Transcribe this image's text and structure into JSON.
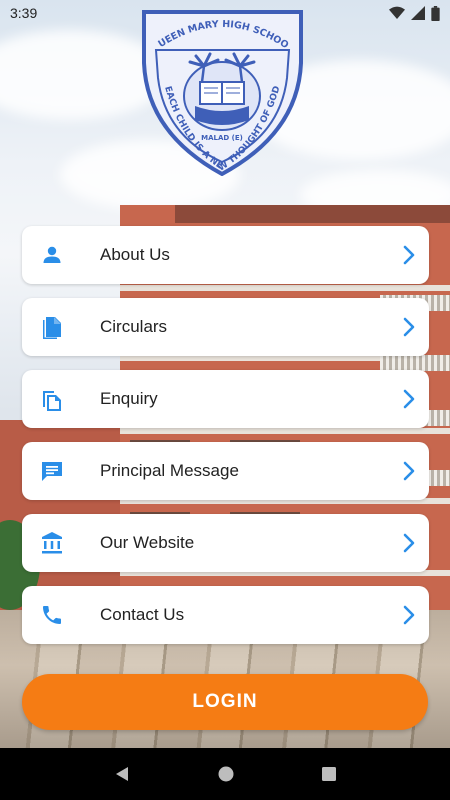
{
  "status_bar": {
    "time": "3:39"
  },
  "crest": {
    "top_text": "QUEEN MARY HIGH SCHOOL",
    "motto": "EACH CHILD IS A NEW THOUGHT OF GOD",
    "location": "MALAD (E)"
  },
  "menu": {
    "items": [
      {
        "label": "About Us",
        "icon": "person-icon"
      },
      {
        "label": "Circulars",
        "icon": "document-icon"
      },
      {
        "label": "Enquiry",
        "icon": "copy-icon"
      },
      {
        "label": "Principal Message",
        "icon": "message-icon"
      },
      {
        "label": "Our Website",
        "icon": "bank-icon"
      },
      {
        "label": "Contact Us",
        "icon": "phone-icon"
      }
    ]
  },
  "login": {
    "label": "LOGIN"
  },
  "colors": {
    "accent": "#2a8ee8",
    "login": "#f57c14"
  }
}
